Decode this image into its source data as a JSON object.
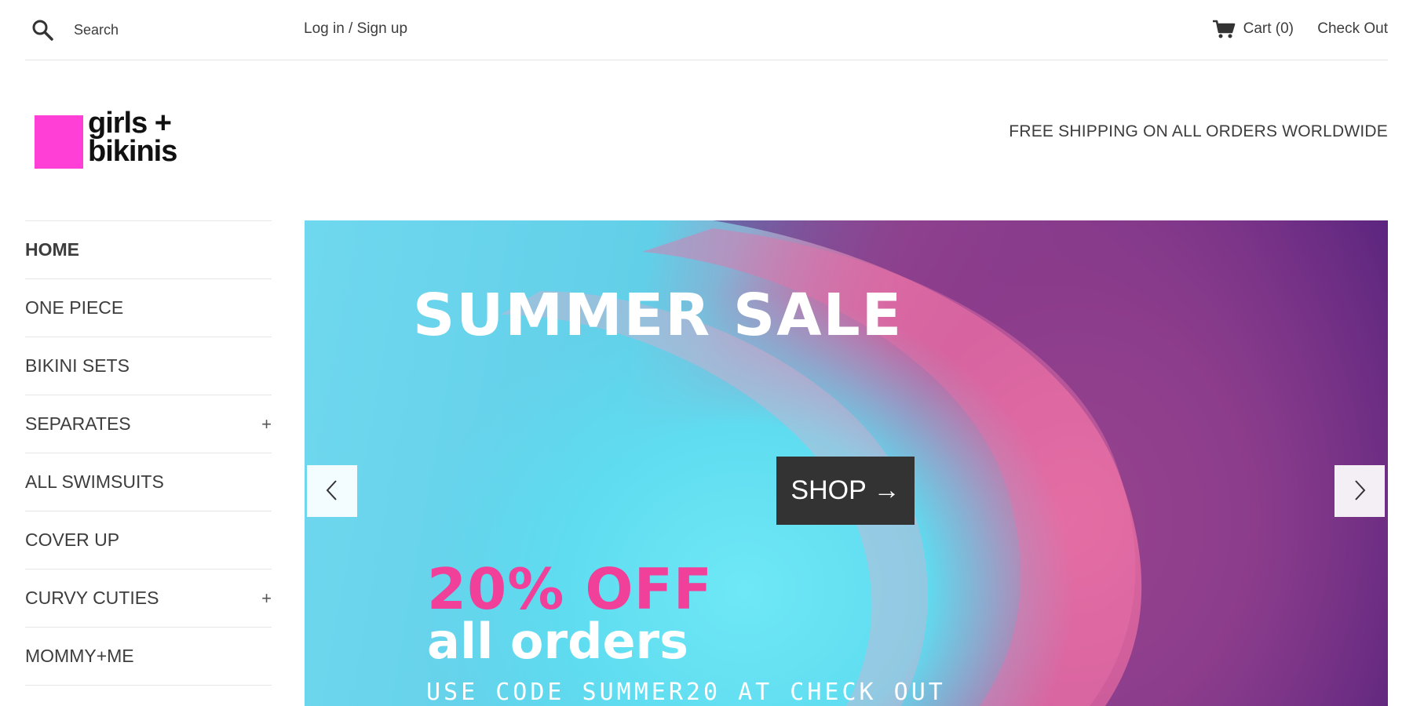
{
  "topbar": {
    "search_placeholder": "Search",
    "login_label": "Log in / Sign up",
    "cart_label": "Cart (0)",
    "checkout_label": "Check Out",
    "icons": {
      "search": "search-icon",
      "cart": "cart-icon"
    }
  },
  "header": {
    "logo_text_line1": "girls +",
    "logo_text_line2": "bikinis",
    "logo_color": "#ff3fd6",
    "shipping_notice": "FREE SHIPPING ON ALL ORDERS WORLDWIDE"
  },
  "sidebar": {
    "items": [
      {
        "label": "HOME",
        "active": true,
        "expandable": false
      },
      {
        "label": "ONE PIECE",
        "active": false,
        "expandable": false
      },
      {
        "label": "BIKINI SETS",
        "active": false,
        "expandable": false
      },
      {
        "label": "SEPARATES",
        "active": false,
        "expandable": true
      },
      {
        "label": "ALL SWIMSUITS",
        "active": false,
        "expandable": false
      },
      {
        "label": "COVER UP",
        "active": false,
        "expandable": false
      },
      {
        "label": "CURVY CUTIES",
        "active": false,
        "expandable": true
      },
      {
        "label": "MOMMY+ME",
        "active": false,
        "expandable": false
      }
    ],
    "expand_symbol": "+"
  },
  "hero": {
    "title": "SUMMER SALE",
    "discount": "20% OFF",
    "subtitle": "all orders",
    "code_text": "USE CODE SUMMER20 AT CHECK OUT",
    "shop_label": "SHOP →",
    "accent_pink": "#f0409a",
    "button_color": "#333333"
  }
}
